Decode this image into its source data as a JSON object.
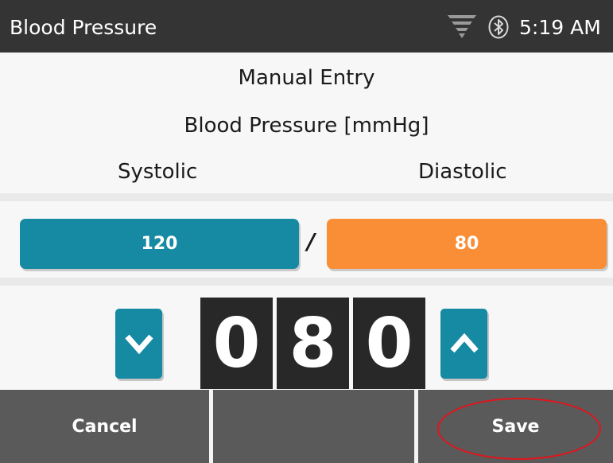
{
  "status_bar": {
    "title": "Blood Pressure",
    "time": "5:19 AM",
    "icons": [
      "wifi-signal-icon",
      "bluetooth-icon"
    ]
  },
  "entry": {
    "mode_heading": "Manual Entry",
    "measure_heading": "Blood Pressure [mmHg]",
    "systolic_label": "Systolic",
    "diastolic_label": "Diastolic",
    "systolic_value": "120",
    "separator": "/",
    "diastolic_value": "80"
  },
  "stepper": {
    "digits": [
      "0",
      "8",
      "0"
    ],
    "decrement_icon": "chevron-down-icon",
    "increment_icon": "chevron-up-icon"
  },
  "softkeys": {
    "cancel": "Cancel",
    "middle": "",
    "save": "Save"
  },
  "colors": {
    "systolic": "#168aa3",
    "diastolic": "#fa8e36",
    "status_bar": "#343434",
    "softkey_bar": "#5a5a5a",
    "highlight": "#e3141c"
  }
}
